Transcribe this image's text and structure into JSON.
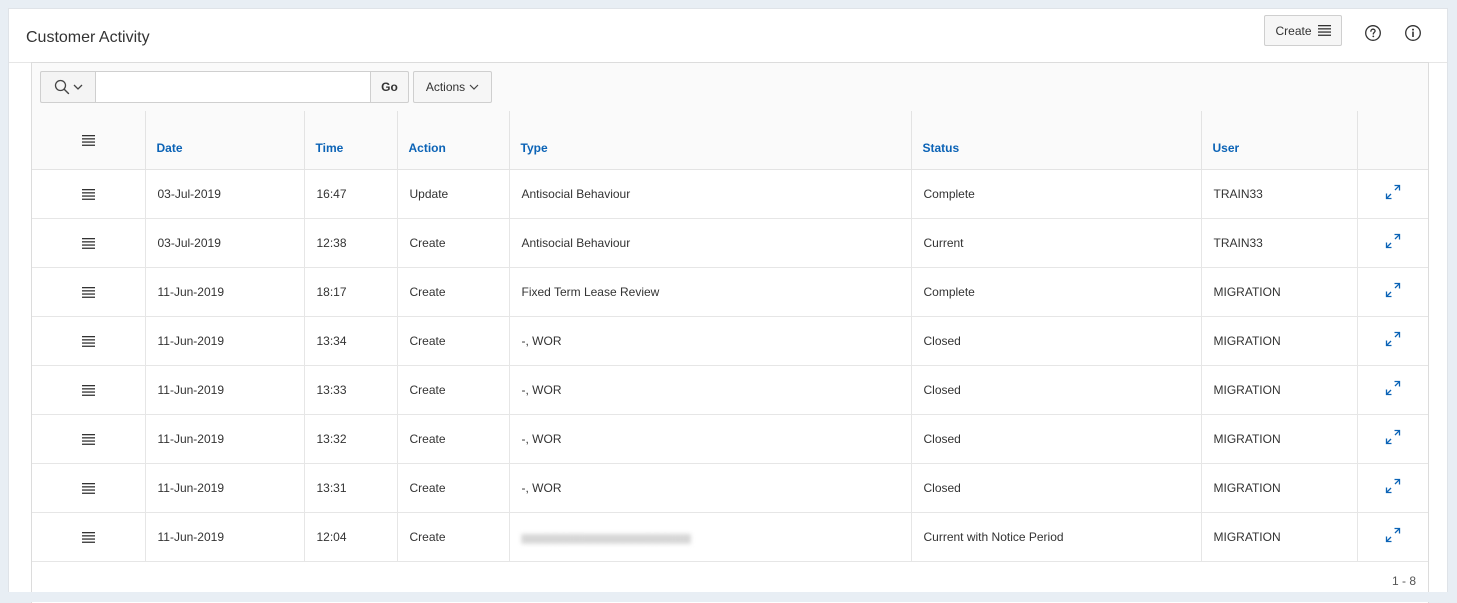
{
  "region": {
    "title": "Customer Activity",
    "create_label": "Create"
  },
  "toolbar": {
    "search_value": "",
    "go_label": "Go",
    "actions_label": "Actions"
  },
  "columns": [
    "Date",
    "Time",
    "Action",
    "Type",
    "Status",
    "User"
  ],
  "rows": [
    {
      "date": "03-Jul-2019",
      "time": "16:47",
      "action": "Update",
      "type": "Antisocial Behaviour",
      "status": "Complete",
      "user": "TRAIN33"
    },
    {
      "date": "03-Jul-2019",
      "time": "12:38",
      "action": "Create",
      "type": "Antisocial Behaviour",
      "status": "Current",
      "user": "TRAIN33"
    },
    {
      "date": "11-Jun-2019",
      "time": "18:17",
      "action": "Create",
      "type": "Fixed Term Lease Review",
      "status": "Complete",
      "user": "MIGRATION"
    },
    {
      "date": "11-Jun-2019",
      "time": "13:34",
      "action": "Create",
      "type": "-, WOR",
      "status": "Closed",
      "user": "MIGRATION"
    },
    {
      "date": "11-Jun-2019",
      "time": "13:33",
      "action": "Create",
      "type": "-, WOR",
      "status": "Closed",
      "user": "MIGRATION"
    },
    {
      "date": "11-Jun-2019",
      "time": "13:32",
      "action": "Create",
      "type": "-, WOR",
      "status": "Closed",
      "user": "MIGRATION"
    },
    {
      "date": "11-Jun-2019",
      "time": "13:31",
      "action": "Create",
      "type": "-, WOR",
      "status": "Closed",
      "user": "MIGRATION"
    },
    {
      "date": "11-Jun-2019",
      "time": "12:04",
      "action": "Create",
      "type": "",
      "status": "Current with Notice Period",
      "user": "MIGRATION"
    }
  ],
  "pagination": "1 - 8",
  "colors": {
    "link_blue": "#0b63b6",
    "header_bg": "#fafafa",
    "border": "#e3e3e3"
  },
  "icons": {
    "search": "search-icon",
    "chevron": "chevron-down-icon",
    "menu": "hamburger-icon",
    "help": "help-icon",
    "info": "info-icon",
    "expand": "expand-icon"
  }
}
